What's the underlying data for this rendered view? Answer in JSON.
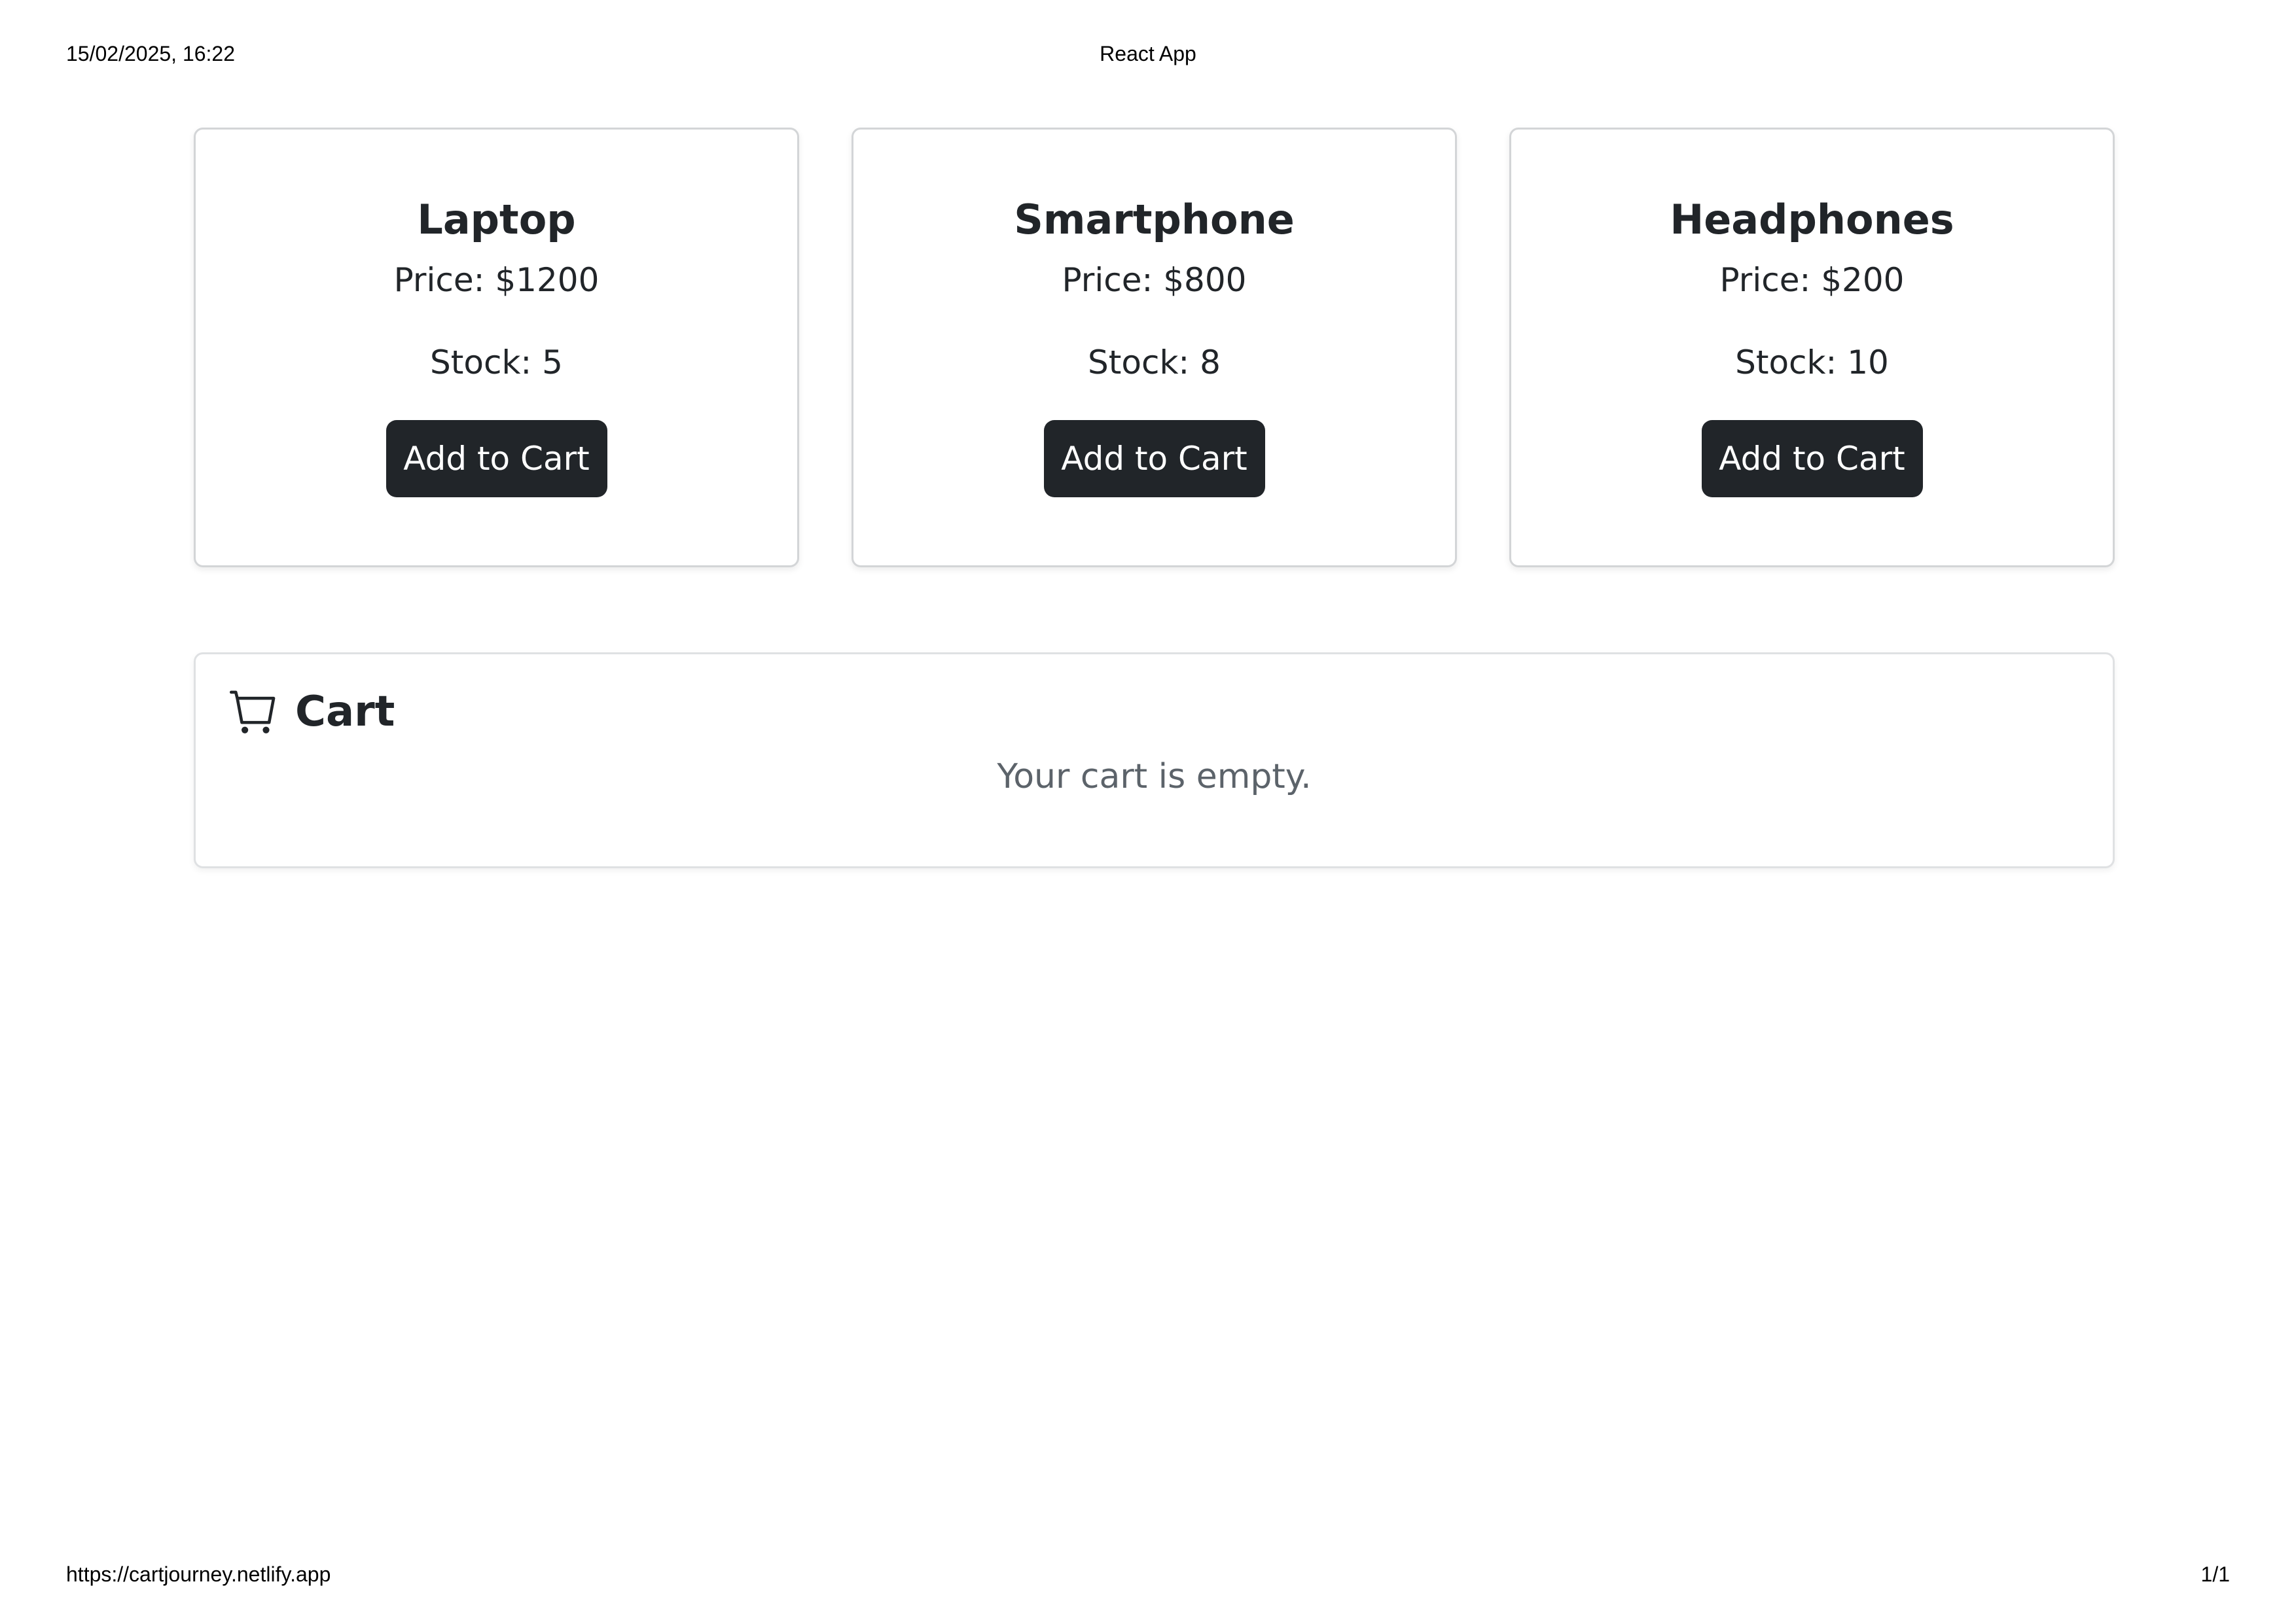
{
  "print_header": {
    "datetime": "15/02/2025, 16:22",
    "title": "React App"
  },
  "print_footer": {
    "url": "https://cartjourney.netlify.app",
    "page": "1/1"
  },
  "products": [
    {
      "name": "Laptop",
      "price": "Price: $1200",
      "stock": "Stock: 5",
      "button": "Add to Cart"
    },
    {
      "name": "Smartphone",
      "price": "Price: $800",
      "stock": "Stock: 8",
      "button": "Add to Cart"
    },
    {
      "name": "Headphones",
      "price": "Price: $200",
      "stock": "Stock: 10",
      "button": "Add to Cart"
    }
  ],
  "cart": {
    "icon": "cart-icon",
    "title": "Cart",
    "empty_message": "Your cart is empty."
  },
  "colors": {
    "button_bg": "#212529",
    "button_text": "#ffffff",
    "muted_text": "#5c636a",
    "card_border": "#d3d5d7"
  }
}
